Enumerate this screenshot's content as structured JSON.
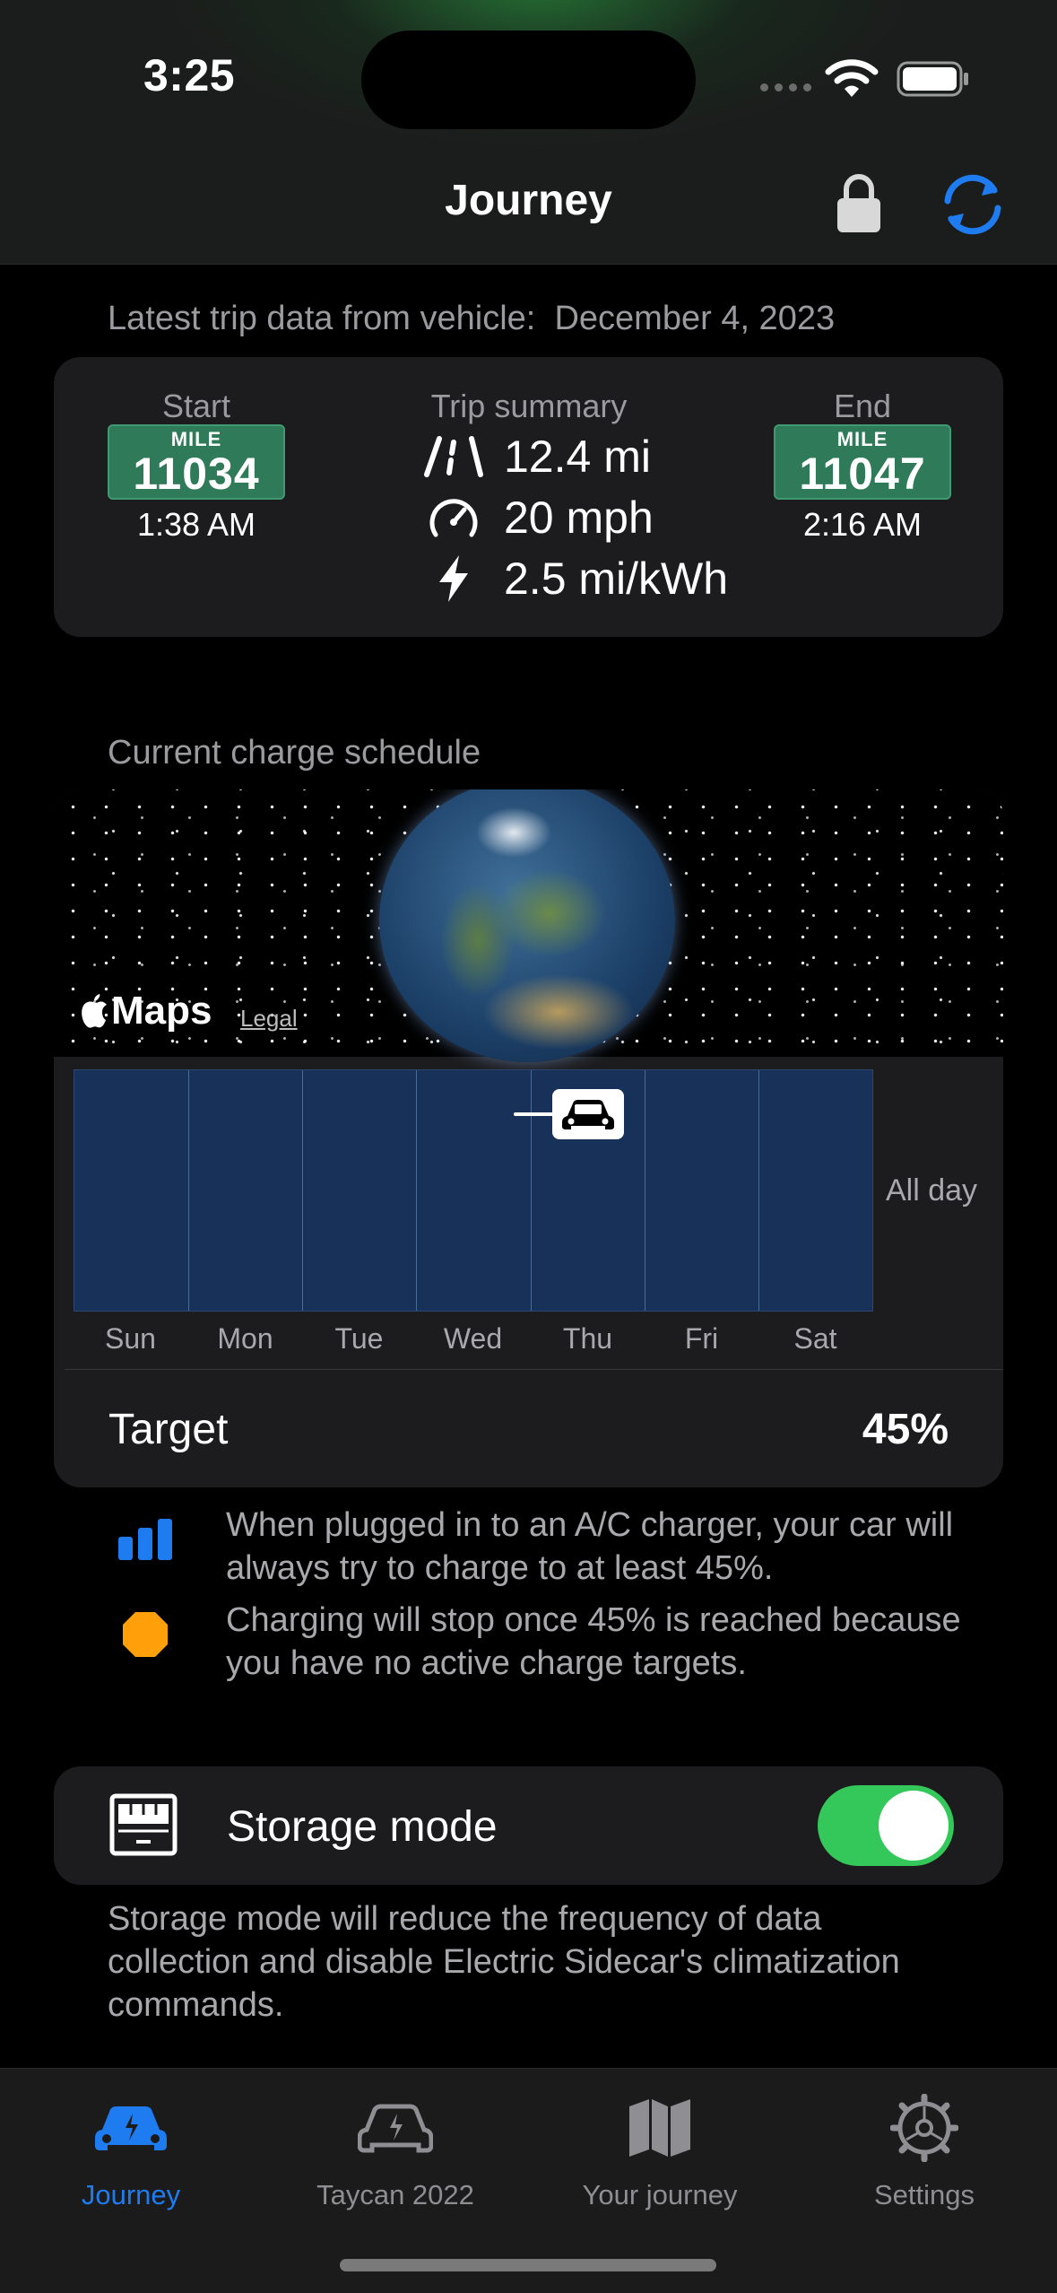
{
  "status_bar": {
    "time": "3:25"
  },
  "nav": {
    "title": "Journey",
    "lock_icon": "lock-icon",
    "sync_icon": "sync-icon"
  },
  "trip": {
    "caption_label": "Latest trip data from vehicle:",
    "caption_date": "December 4, 2023",
    "start": {
      "header": "Start",
      "mile_label": "MILE",
      "odometer": "11034",
      "time": "1:38 AM"
    },
    "summary": {
      "header": "Trip summary",
      "distance": "12.4 mi",
      "speed": "20 mph",
      "efficiency": "2.5 mi/kWh"
    },
    "end": {
      "header": "End",
      "mile_label": "MILE",
      "odometer": "11047",
      "time": "2:16 AM"
    }
  },
  "schedule": {
    "caption": "Current charge schedule",
    "maps_brand": "Maps",
    "legal": "Legal",
    "days": [
      "Sun",
      "Mon",
      "Tue",
      "Wed",
      "Thu",
      "Fri",
      "Sat"
    ],
    "all_day_label": "All day",
    "marker_day": "Thu",
    "target_label": "Target",
    "target_value": "45%"
  },
  "info": {
    "ac_charge": "When plugged in to an A/C charger, your car will always try to charge to at least 45%.",
    "stop_charge": "Charging will stop once 45% is reached because you have no active charge targets."
  },
  "storage": {
    "label": "Storage mode",
    "enabled": true,
    "note": "Storage mode will reduce the frequency of data collection and disable Electric Sidecar's climatization commands."
  },
  "tabs": [
    {
      "label": "Journey",
      "icon": "car-charging-icon",
      "active": true
    },
    {
      "label": "Taycan 2022",
      "icon": "car-bolt-icon",
      "active": false
    },
    {
      "label": "Your journey",
      "icon": "map-icon",
      "active": false
    },
    {
      "label": "Settings",
      "icon": "gear-icon",
      "active": false
    }
  ],
  "colors": {
    "accent_blue": "#1e7cf0",
    "toggle_green": "#34c759",
    "mile_sign_green": "#2f7a58",
    "schedule_blue": "#183158",
    "warning_orange": "#ff9f0a"
  }
}
